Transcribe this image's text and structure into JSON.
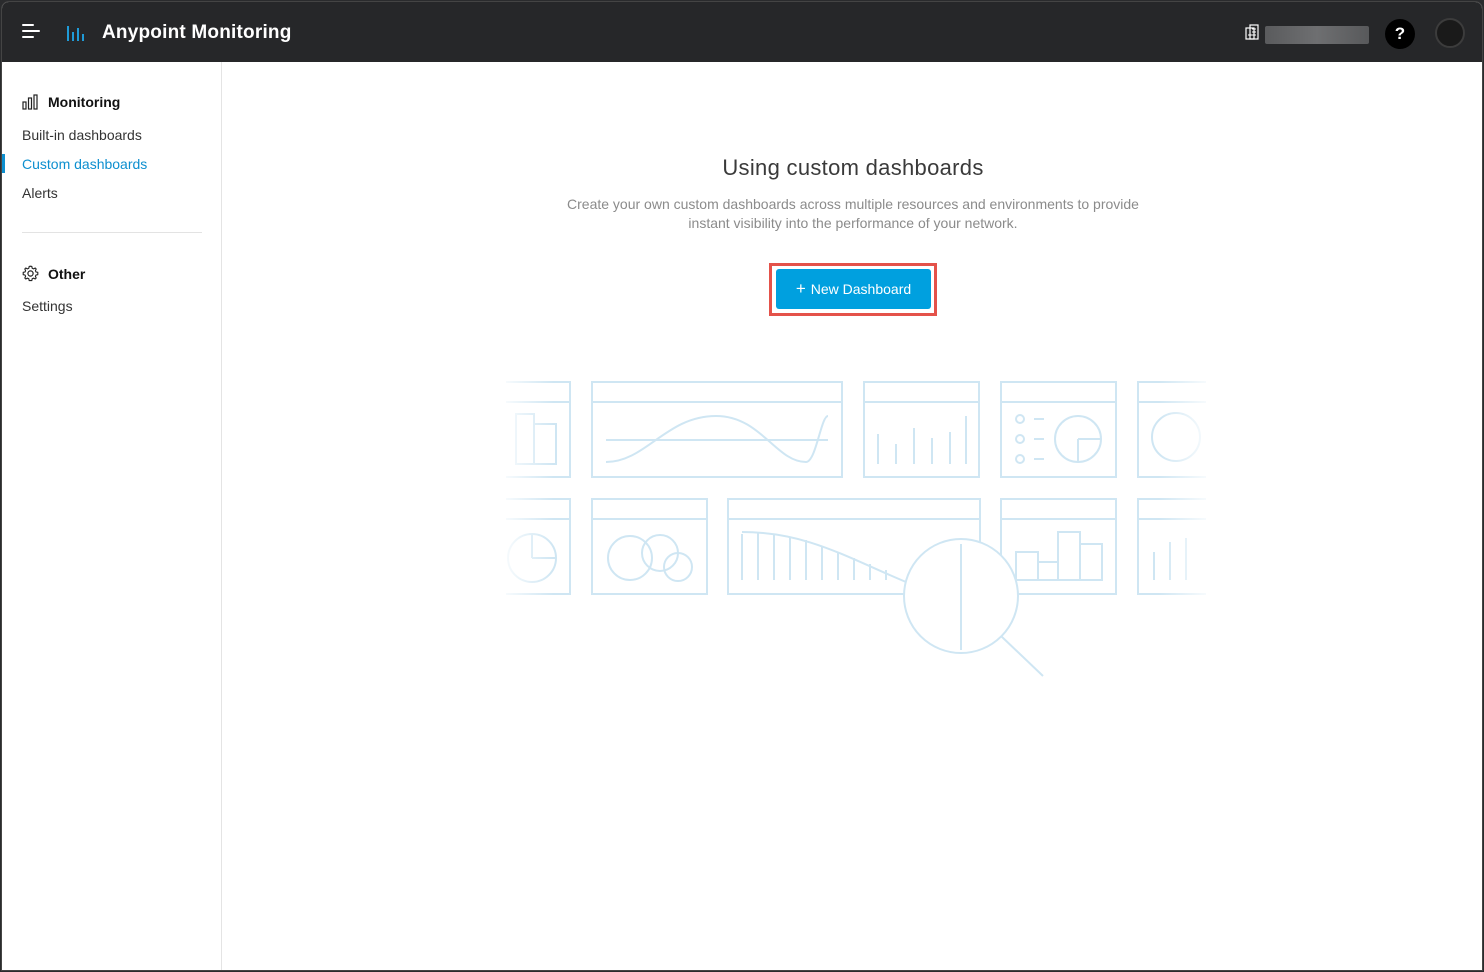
{
  "app": {
    "title": "Anypoint Monitoring",
    "org_name": "",
    "help_label": "?"
  },
  "sidebar": {
    "sections": [
      {
        "heading": "Monitoring",
        "icon": "bar-chart-icon",
        "items": [
          {
            "label": "Built-in dashboards",
            "active": false
          },
          {
            "label": "Custom dashboards",
            "active": true
          },
          {
            "label": "Alerts",
            "active": false
          }
        ]
      },
      {
        "heading": "Other",
        "icon": "gear-icon",
        "items": [
          {
            "label": "Settings",
            "active": false
          }
        ]
      }
    ]
  },
  "main": {
    "title": "Using custom dashboards",
    "description": "Create your own custom dashboards across multiple resources and environments to provide instant visibility into the performance of your network.",
    "new_dashboard_label": "New Dashboard"
  },
  "colors": {
    "topbar": "#262729",
    "accent": "#00a0df",
    "active_link": "#0d8fcf",
    "highlight": "#e4524a"
  }
}
